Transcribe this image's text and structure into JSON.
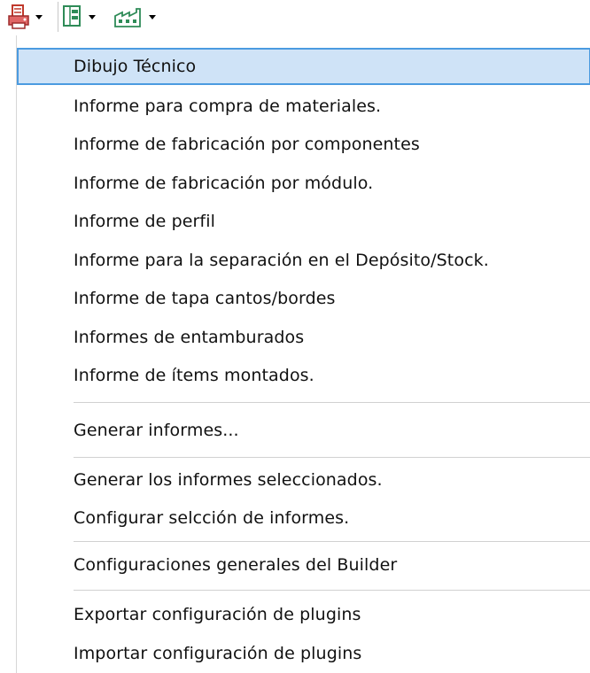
{
  "toolbar": {
    "buttons": [
      {
        "icon": "report-printer-icon"
      },
      {
        "icon": "layout-panel-icon"
      },
      {
        "icon": "factory-icon"
      }
    ]
  },
  "menu": {
    "items": [
      "Dibujo Técnico",
      "Informe para compra de materiales.",
      "Informe de fabricación por componentes",
      "Informe de fabricación por módulo.",
      "Informe de perfil",
      "Informe para la separación en el Depósito/Stock.",
      "Informe de tapa cantos/bordes",
      "Informes de entamburados",
      "Informe de ítems montados.",
      "Generar informes...",
      "Generar los informes seleccionados.",
      "Configurar selcción de informes.",
      "Configuraciones generales del Builder",
      "Exportar configuración de plugins",
      "Importar configuración de plugins"
    ],
    "highlighted_index": 0
  },
  "colors": {
    "highlight_bg": "#cfe3f7",
    "highlight_border": "#4b9be0",
    "text": "#111111",
    "separator": "#d1d1d1",
    "icon_red": "#c0392b",
    "icon_green": "#2e8b57"
  }
}
